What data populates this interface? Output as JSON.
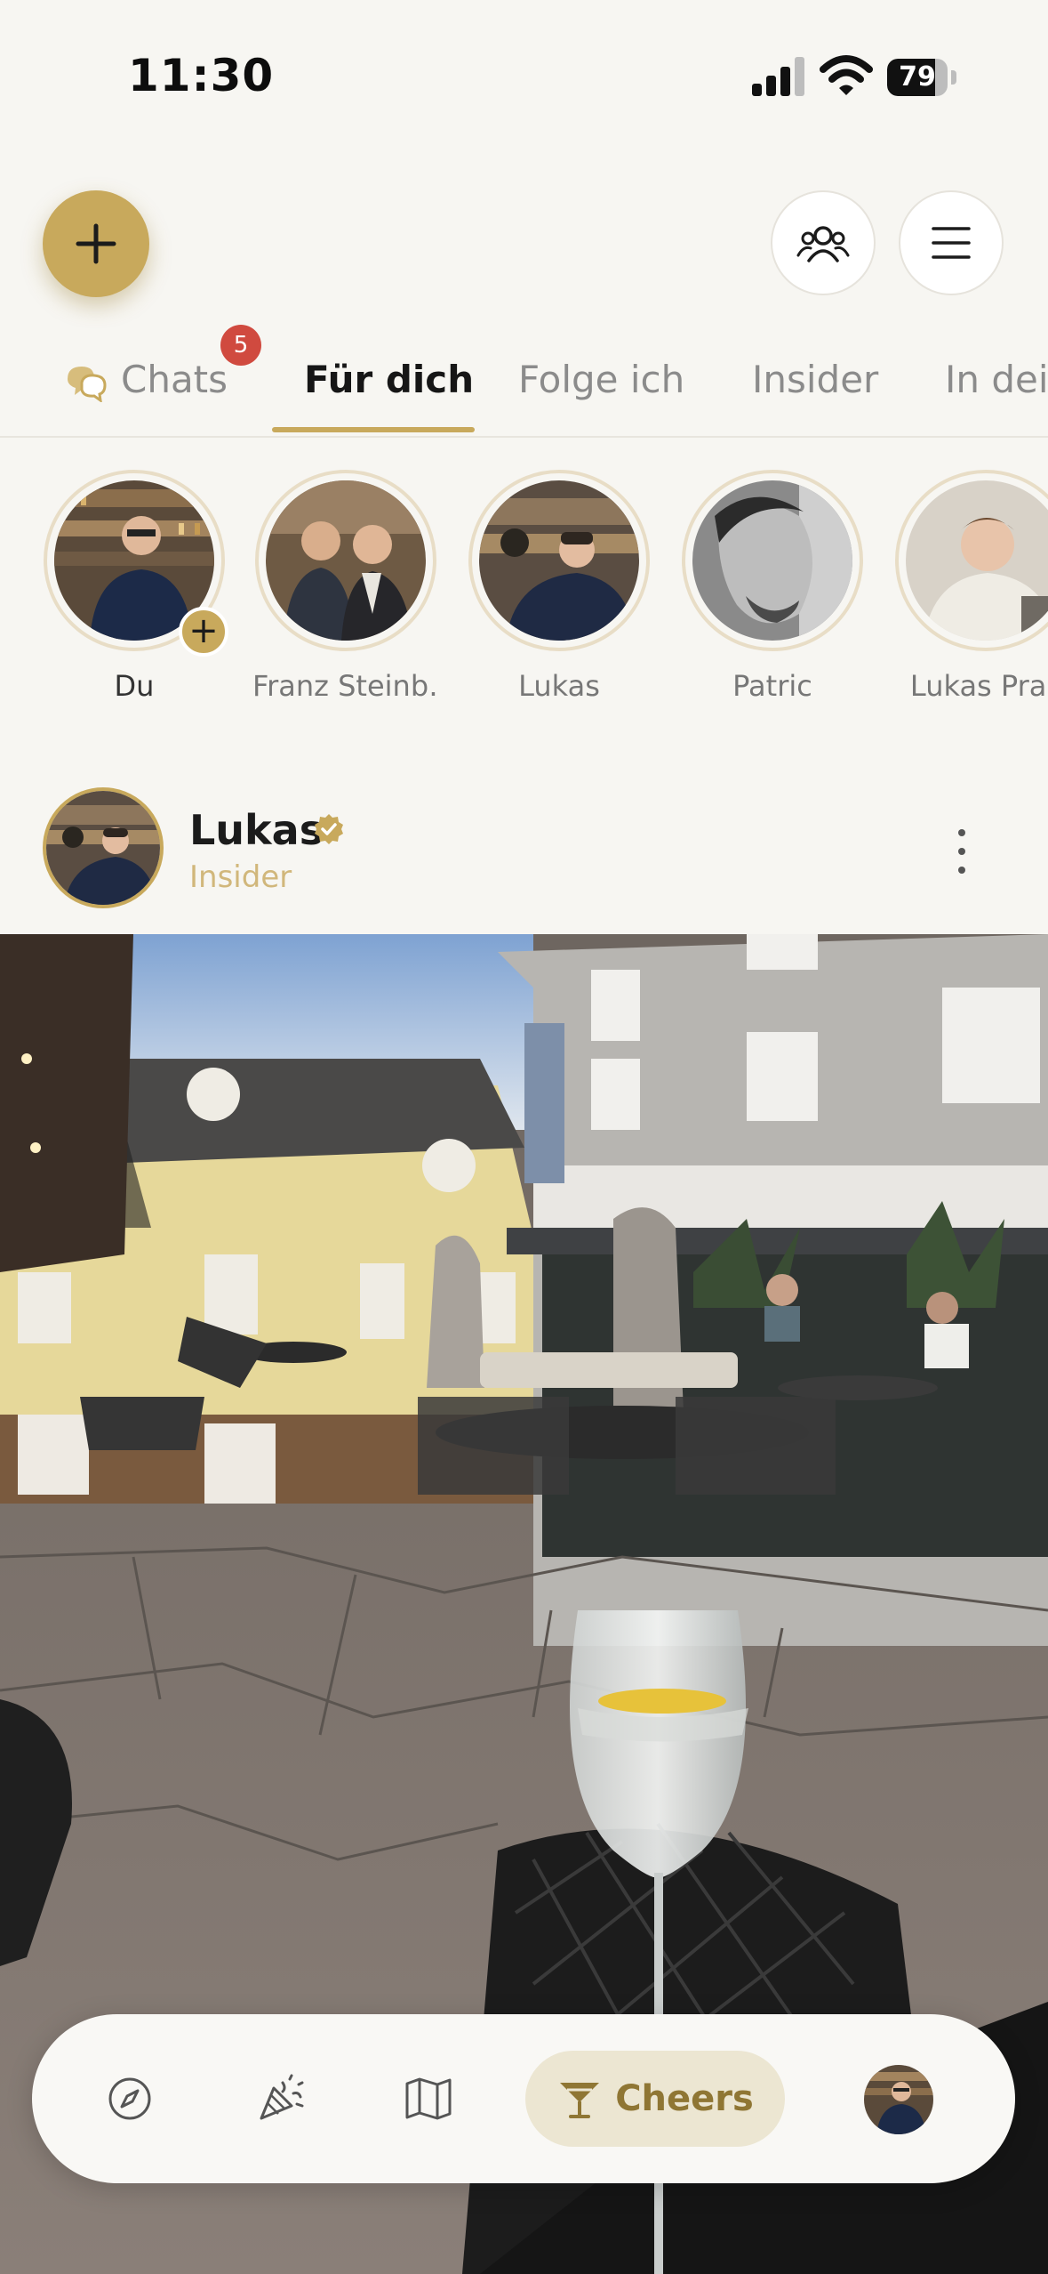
{
  "status_bar": {
    "time": "11:30",
    "battery": "79",
    "battery_level": 0.79
  },
  "tabs": [
    {
      "label": "Chats",
      "badge": "5"
    },
    {
      "label": "Für dich",
      "active": true
    },
    {
      "label": "Folge ich"
    },
    {
      "label": "Insider"
    },
    {
      "label": "In dein"
    }
  ],
  "stories": [
    {
      "name": "Du"
    },
    {
      "name": "Franz Steinb…"
    },
    {
      "name": "Lukas"
    },
    {
      "name": "Patric"
    },
    {
      "name": "Lukas Pras"
    }
  ],
  "post": {
    "author": "Lukas",
    "role": "Insider",
    "verified": true
  },
  "bottom_nav": {
    "items": [
      "compass-icon",
      "party-popper-icon",
      "map-icon",
      "cocktail-glass-icon",
      "avatar"
    ],
    "active_label": "Cheers"
  },
  "colors": {
    "accent": "#c8a95c",
    "badge": "#d04a3f",
    "background": "#f7f6f2"
  }
}
